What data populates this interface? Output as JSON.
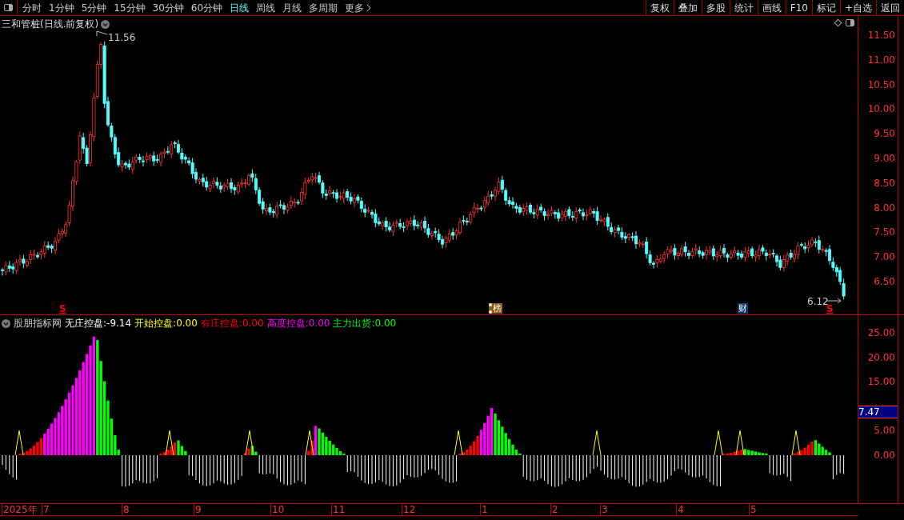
{
  "toolbar": {
    "periods": [
      {
        "label": "分时",
        "selected": false
      },
      {
        "label": "1分钟",
        "selected": false
      },
      {
        "label": "5分钟",
        "selected": false
      },
      {
        "label": "15分钟",
        "selected": false
      },
      {
        "label": "30分钟",
        "selected": false
      },
      {
        "label": "60分钟",
        "selected": false
      },
      {
        "label": "日线",
        "selected": true
      },
      {
        "label": "周线",
        "selected": false
      },
      {
        "label": "月线",
        "selected": false
      },
      {
        "label": "多周期",
        "selected": false
      },
      {
        "label": "更多",
        "selected": false
      }
    ],
    "actions": [
      "复权",
      "叠加",
      "多股",
      "统计",
      "画线",
      "F10",
      "标记",
      "+自选",
      "返回"
    ]
  },
  "main_chart": {
    "title": "三和管桩(日线.前复权)",
    "high_label": "11.56",
    "low_label": "6.12",
    "events": [
      {
        "kind": "s",
        "label": "S"
      },
      {
        "kind": "longhu",
        "label": "榜"
      },
      {
        "kind": "cai",
        "label": "财"
      },
      {
        "kind": "s",
        "label": "S"
      }
    ],
    "y_axis": [
      "11.50",
      "11.00",
      "10.50",
      "10.00",
      "9.50",
      "9.00",
      "8.50",
      "8.00",
      "7.50",
      "7.00",
      "6.50"
    ]
  },
  "indicator": {
    "name": "股朋指标网",
    "items": [
      {
        "label": "无庄控盘:",
        "value": "-9.14",
        "color": "#ffffff"
      },
      {
        "label": "开始控盘:",
        "value": "0.00",
        "color": "#ffff00"
      },
      {
        "label": "有庄控盘:",
        "value": "0.00",
        "color": "#ff0000"
      },
      {
        "label": "高度控盘:",
        "value": "0.00",
        "color": "#ff00ff"
      },
      {
        "label": "主力出货:",
        "value": "0.00",
        "color": "#00ff00"
      }
    ],
    "y_axis": [
      "25.00",
      "20.00",
      "15.00",
      "5.00",
      "0.00"
    ],
    "cursor_value": "7.47"
  },
  "x_axis": [
    "2025年",
    "7",
    "8",
    "9",
    "10",
    "11",
    "12",
    "1",
    "2",
    "3",
    "4",
    "5"
  ]
}
